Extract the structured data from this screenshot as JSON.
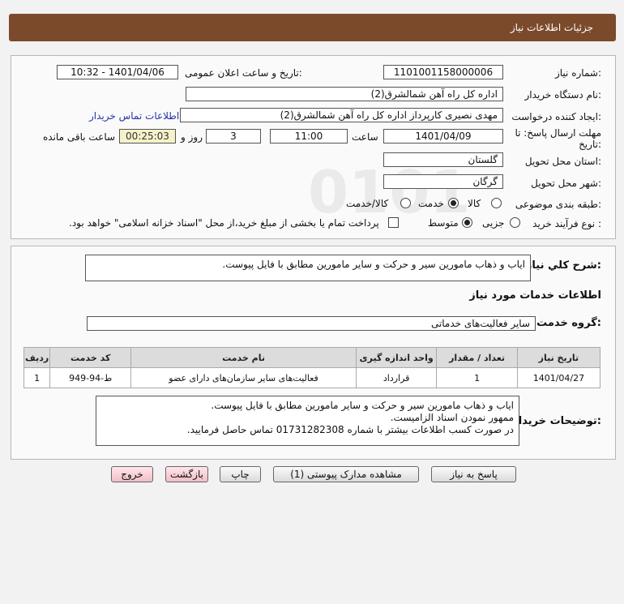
{
  "header": {
    "title": "جزئیات اطلاعات نیاز"
  },
  "info": {
    "need_number_label": "شماره نیاز:",
    "need_number": "1101001158000006",
    "announce_label": "تاریخ و ساعت اعلان عمومی:",
    "announce_value": "1401/04/06 - 10:32",
    "buyer_org_label": "نام دستگاه خریدار:",
    "buyer_org": "اداره کل راه آهن شمالشرق(2)",
    "creator_label": "ایجاد کننده درخواست:",
    "creator": "مهدی نصیری کارپرداز اداره کل راه آهن شمالشرق(2)",
    "contact_link": "اطلاعات تماس خریدار",
    "deadline_label_1": "مهلت ارسال پاسخ: تا",
    "deadline_label_2": "تاریخ:",
    "deadline_date": "1401/04/09",
    "time_label": "ساعت",
    "deadline_time": "11:00",
    "days": "3",
    "days_label": "روز و",
    "remaining_time": "00:25:03",
    "remaining_label": "ساعت باقی مانده",
    "province_label": "استان محل تحویل:",
    "province": "گلستان",
    "city_label": "شهر محل تحویل:",
    "city": "گرگان",
    "category_label": "طبقه بندی موضوعی:",
    "category_options": [
      "کالا",
      "خدمت",
      "کالا/خدمت"
    ],
    "category_selected": "خدمت",
    "process_label": "نوع فرآیند خرید :",
    "process_options": [
      "جزیی",
      "متوسط"
    ],
    "process_selected": "متوسط",
    "payment_note": "پرداخت تمام یا بخشی از مبلغ خرید،از محل \"اسناد خزانه اسلامی\" خواهد بود."
  },
  "description": {
    "label": "شرح کلي نیاز:",
    "text": "اياب و ذهاب مامورين سير و حركت و ساير مامورين مطابق با فايل پيوست."
  },
  "services": {
    "title": "اطلاعات خدمات مورد نیاز",
    "group_label": "گروه خدمت:",
    "group_value": "سایر فعالیت‌های خدماتی",
    "columns": [
      "ردیف",
      "کد خدمت",
      "نام خدمت",
      "واحد اندازه گیری",
      "تعداد / مقدار",
      "تاریخ نیاز"
    ],
    "rows": [
      [
        "1",
        "ط-94-949",
        "فعالیت‌های سایر سازمان‌های دارای عضو",
        "قرارداد",
        "1",
        "1401/04/27"
      ]
    ]
  },
  "buyer_notes": {
    "label": "توضیحات خریدار:",
    "lines": [
      "اياب و ذهاب مامورين سير و حركت و ساير مامورين مطابق با فايل پيوست.",
      "ممهور نمودن اسناد الزامیست.",
      "در صورت کسب اطلاعات بیشتر با شماره 01731282308 تماس حاصل فرمایید."
    ]
  },
  "buttons": {
    "reply": "پاسخ به نیاز",
    "view_docs": "مشاهده مدارک پیوستی (1)",
    "print": "چاپ",
    "back": "بازگشت",
    "exit": "خروج"
  }
}
